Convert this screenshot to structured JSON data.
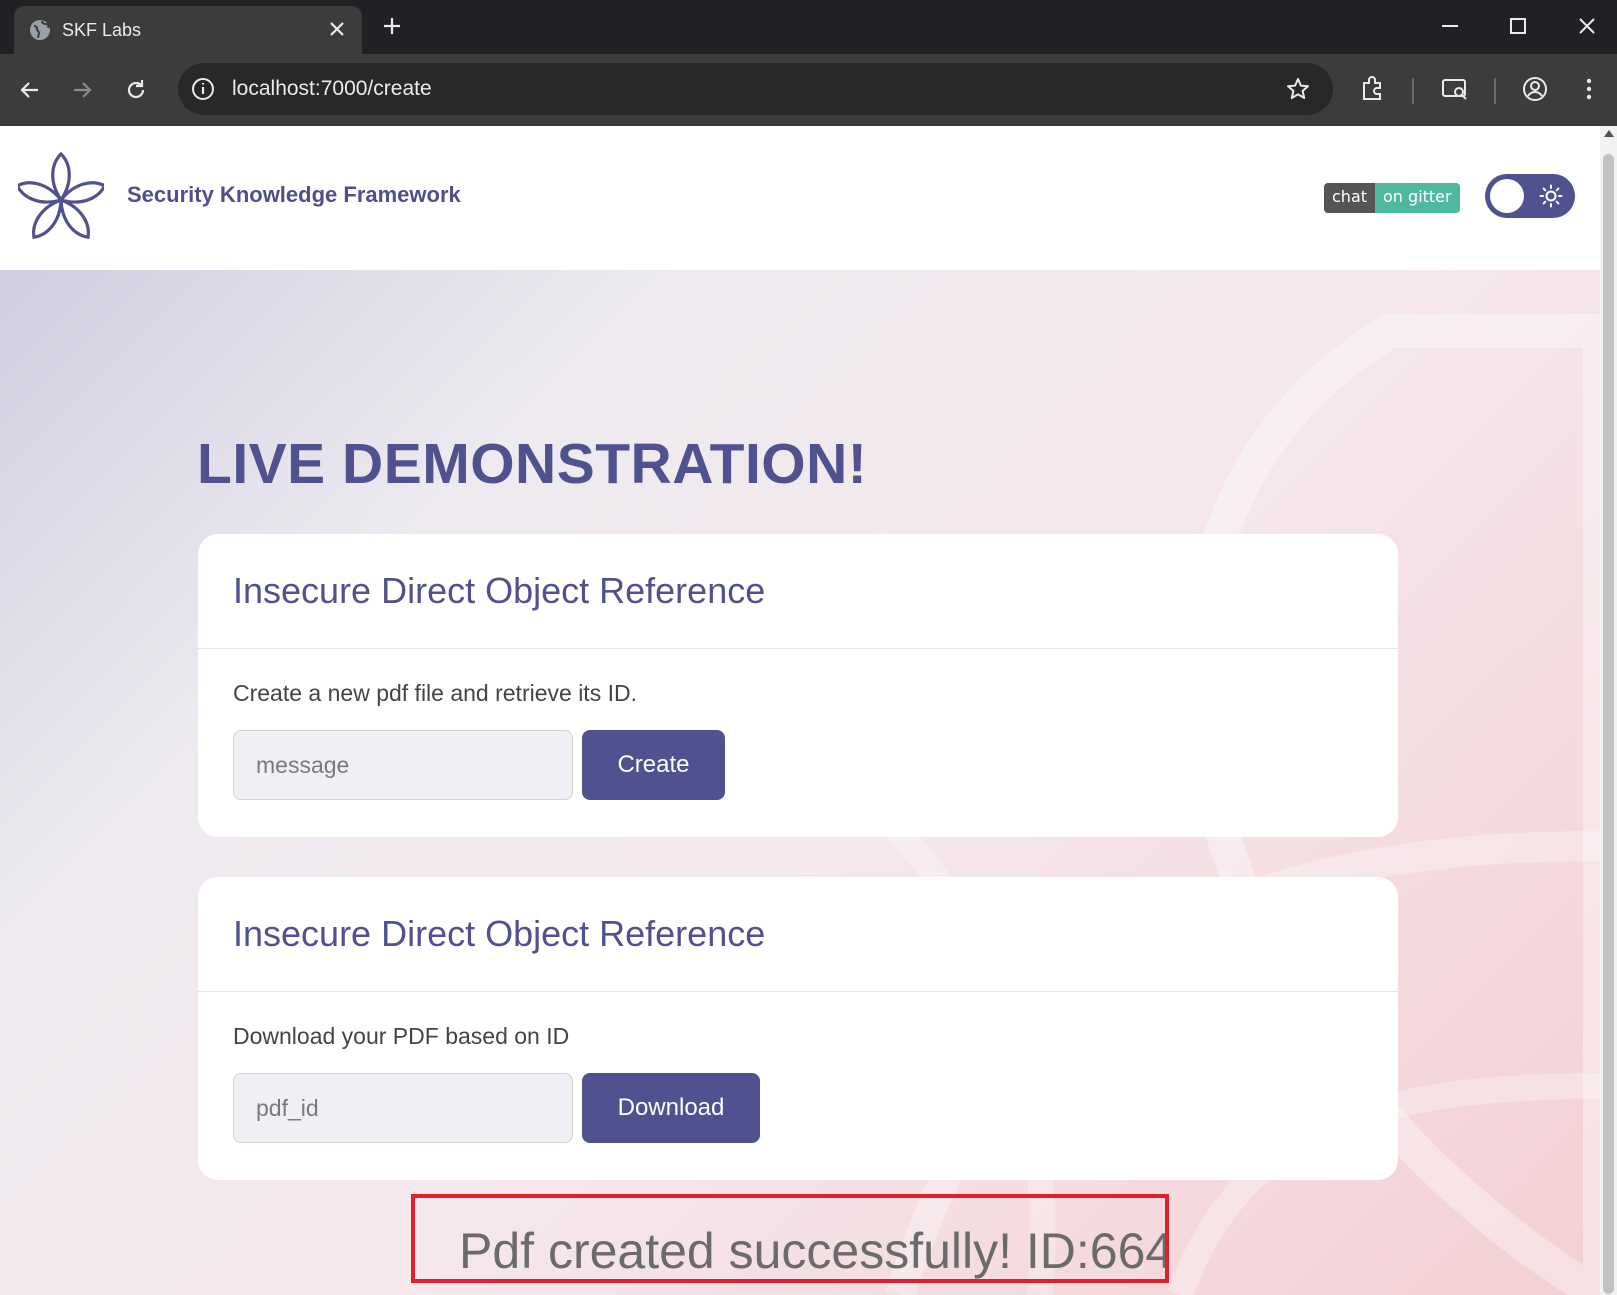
{
  "browser": {
    "tab_title": "SKF Labs",
    "url": "localhost:7000/create",
    "icons": [
      "globe-icon",
      "close-icon",
      "plus-icon",
      "minimize-icon",
      "maximize-icon",
      "close-window-icon",
      "back-icon",
      "forward-icon",
      "reload-icon",
      "info-icon",
      "star-icon",
      "extensions-icon",
      "screen-search-icon",
      "profile-icon",
      "menu-dots-icon"
    ]
  },
  "header": {
    "brand": "Security Knowledge Framework",
    "badge_left": "chat",
    "badge_right": "on gitter",
    "theme_toggle_icon": "sun-icon"
  },
  "main": {
    "heading": "LIVE DEMONSTRATION!",
    "cards": [
      {
        "title": "Insecure Direct Object Reference",
        "description": "Create a new pdf file and retrieve its ID.",
        "input_placeholder": "message",
        "input_value": "",
        "button_label": "Create"
      },
      {
        "title": "Insecure Direct Object Reference",
        "description": "Download your PDF based on ID",
        "input_placeholder": "pdf_id",
        "input_value": "",
        "button_label": "Download"
      }
    ],
    "result_message": "Pdf created successfully! ID:664"
  },
  "colors": {
    "accent": "#50528f",
    "result_border": "#e0202e",
    "badge_green": "#4fb99f",
    "badge_gray": "#555555"
  }
}
